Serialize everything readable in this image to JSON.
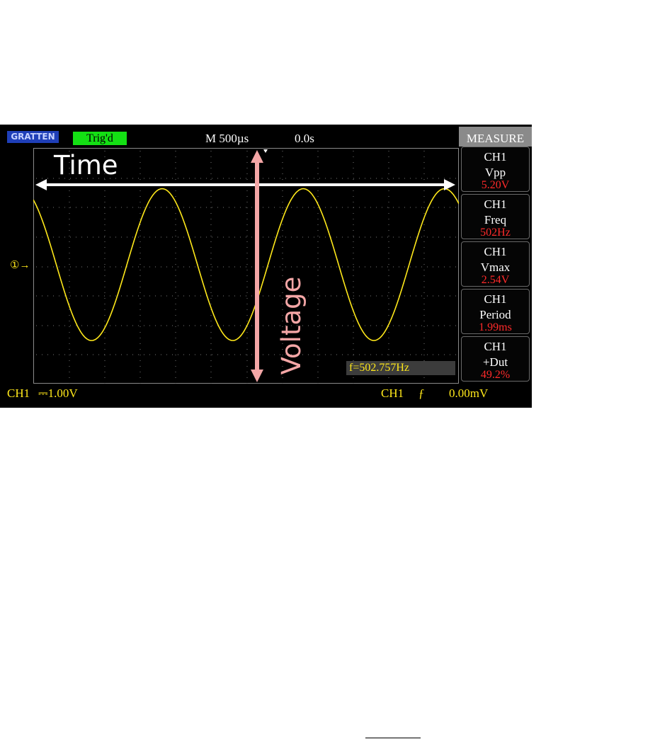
{
  "scope": {
    "brand": "GRATTEN",
    "trigger_status": "Trig'd",
    "timebase": "M 500µs",
    "trigger_position": "0.0s",
    "channel_marker": "①→",
    "bottom": {
      "channel": "CH1",
      "scale": "⎓1.00V",
      "trigger_channel": "CH1",
      "trigger_edge": "ƒ",
      "trigger_level": "0.00mV"
    },
    "frequency_counter": "f=502.757Hz",
    "measure_panel": {
      "title": "MEASURE",
      "items": [
        {
          "channel": "CH1",
          "label": "Vpp",
          "value": "5.20V"
        },
        {
          "channel": "CH1",
          "label": "Freq",
          "value": "502Hz"
        },
        {
          "channel": "CH1",
          "label": "Vmax",
          "value": "2.54V"
        },
        {
          "channel": "CH1",
          "label": "Period",
          "value": "1.99ms"
        },
        {
          "channel": "CH1",
          "label": "+Dut",
          "value": "49.2%"
        }
      ]
    }
  },
  "annotations": {
    "time_label": "Time",
    "voltage_label": "Voltage"
  },
  "colors": {
    "trace": "#ffe81a",
    "trig_badge": "#14e014",
    "measure_value": "#ff2a2a",
    "time_arrow": "#ffffff",
    "voltage_arrow": "#f4a6a6"
  }
}
